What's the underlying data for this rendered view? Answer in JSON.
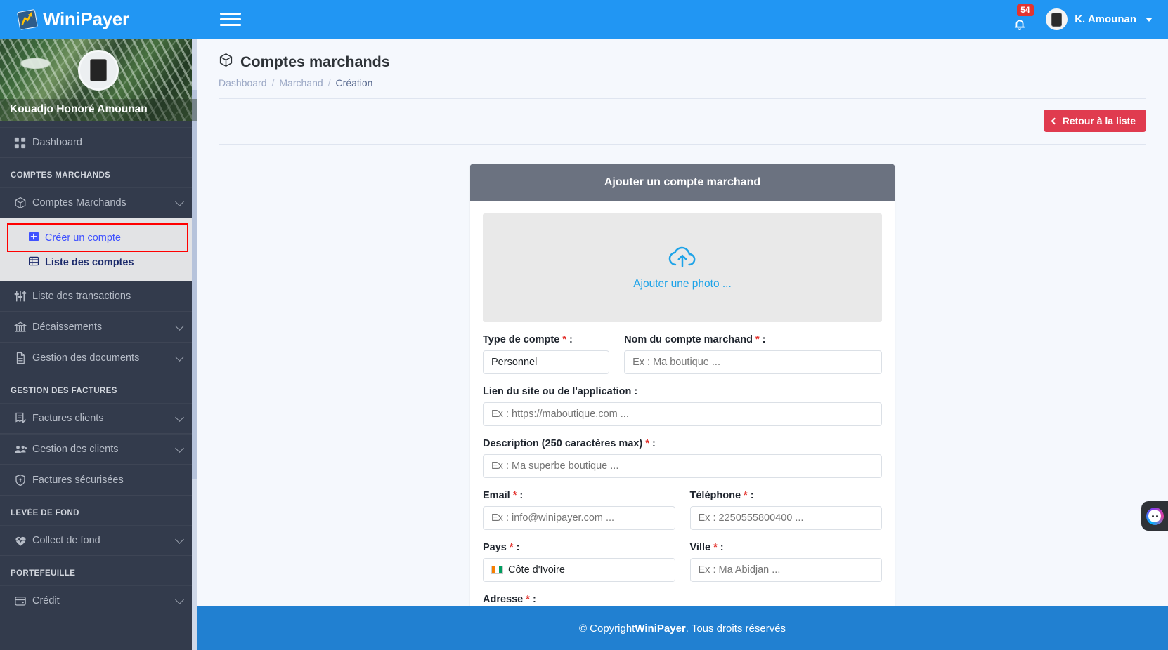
{
  "app": {
    "brand": "WiniPayer",
    "logo_icon": "chart-logo-icon"
  },
  "topbar": {
    "menu_toggle_icon": "hamburger-icon",
    "notification_icon": "bell-icon",
    "notification_count": "54",
    "avatar_icon": "user-avatar",
    "user_name": "K. Amounan",
    "caret_icon": "chevron-down-icon"
  },
  "sidebar": {
    "profile_name": "Kouadjo Honoré Amounan",
    "dashboard": {
      "label": "Dashboard",
      "icon": "grid-icon"
    },
    "sections": [
      {
        "title": "COMPTES MARCHANDS",
        "items": [
          {
            "label": "Comptes Marchands",
            "icon": "box-icon",
            "expandable": true,
            "expanded": true,
            "subitems": [
              {
                "label": "Créer un compte",
                "icon": "plus-square-icon",
                "highlighted": true
              },
              {
                "label": "Liste des comptes",
                "icon": "list-icon",
                "highlighted": false
              }
            ]
          },
          {
            "label": "Liste des transactions",
            "icon": "sliders-icon",
            "expandable": false
          },
          {
            "label": "Décaissements",
            "icon": "bank-icon",
            "expandable": true
          },
          {
            "label": "Gestion des documents",
            "icon": "document-icon",
            "expandable": true
          }
        ]
      },
      {
        "title": "GESTION DES FACTURES",
        "items": [
          {
            "label": "Factures clients",
            "icon": "invoice-check-icon",
            "expandable": true
          },
          {
            "label": "Gestion des clients",
            "icon": "users-icon",
            "expandable": true
          },
          {
            "label": "Factures sécurisées",
            "icon": "shield-lock-icon",
            "expandable": false
          }
        ]
      },
      {
        "title": "LEVÉE DE FOND",
        "items": [
          {
            "label": "Collect de fond",
            "icon": "heart-pulse-icon",
            "expandable": true
          }
        ]
      },
      {
        "title": "PORTEFEUILLE",
        "items": [
          {
            "label": "Crédit",
            "icon": "wallet-icon",
            "expandable": true
          }
        ]
      }
    ]
  },
  "page": {
    "title": "Comptes marchands",
    "title_icon": "box-icon",
    "breadcrumb": [
      {
        "label": "Dashboard",
        "current": false
      },
      {
        "label": "Marchand",
        "current": false
      },
      {
        "label": "Création",
        "current": true
      }
    ],
    "breadcrumb_separator": "/",
    "back_button": {
      "label": "Retour à la liste",
      "icon": "chevron-left-icon"
    }
  },
  "form": {
    "card_title": "Ajouter un compte marchand",
    "upload": {
      "label": "Ajouter une photo ...",
      "icon": "cloud-upload-icon"
    },
    "fields": {
      "type_compte": {
        "label": "Type de compte",
        "required": true,
        "value": "Personnel"
      },
      "nom_compte": {
        "label": "Nom du compte marchand",
        "required": true,
        "placeholder": "Ex : Ma boutique ..."
      },
      "lien_site": {
        "label": "Lien du site ou de l'application",
        "required": false,
        "placeholder": "Ex : https://maboutique.com ..."
      },
      "description": {
        "label": "Description (250 caractères max)",
        "required": true,
        "placeholder": "Ex : Ma superbe boutique ..."
      },
      "email": {
        "label": "Email",
        "required": true,
        "placeholder": "Ex : info@winipayer.com ..."
      },
      "telephone": {
        "label": "Téléphone",
        "required": true,
        "placeholder": "Ex : 2250555800400 ..."
      },
      "pays": {
        "label": "Pays",
        "required": true,
        "value": "Côte d'Ivoire",
        "flag": "ci-flag-icon"
      },
      "ville": {
        "label": "Ville",
        "required": true,
        "placeholder": "Ex : Ma Abidjan ..."
      },
      "adresse": {
        "label": "Adresse",
        "required": true
      }
    },
    "label_suffix": " :"
  },
  "footer": {
    "prefix": "© Copyright ",
    "brand": "WiniPayer",
    "suffix": ". Tous droits réservés"
  },
  "chat_widget": {
    "icon": "chat-avatar-icon"
  },
  "colors": {
    "primary": "#2196f3",
    "footer": "#2180d1",
    "sidebar": "#333b4c",
    "card_header": "#6b7280",
    "danger": "#e03b4f",
    "highlight": "#ff0000",
    "link": "#3f51ff"
  }
}
